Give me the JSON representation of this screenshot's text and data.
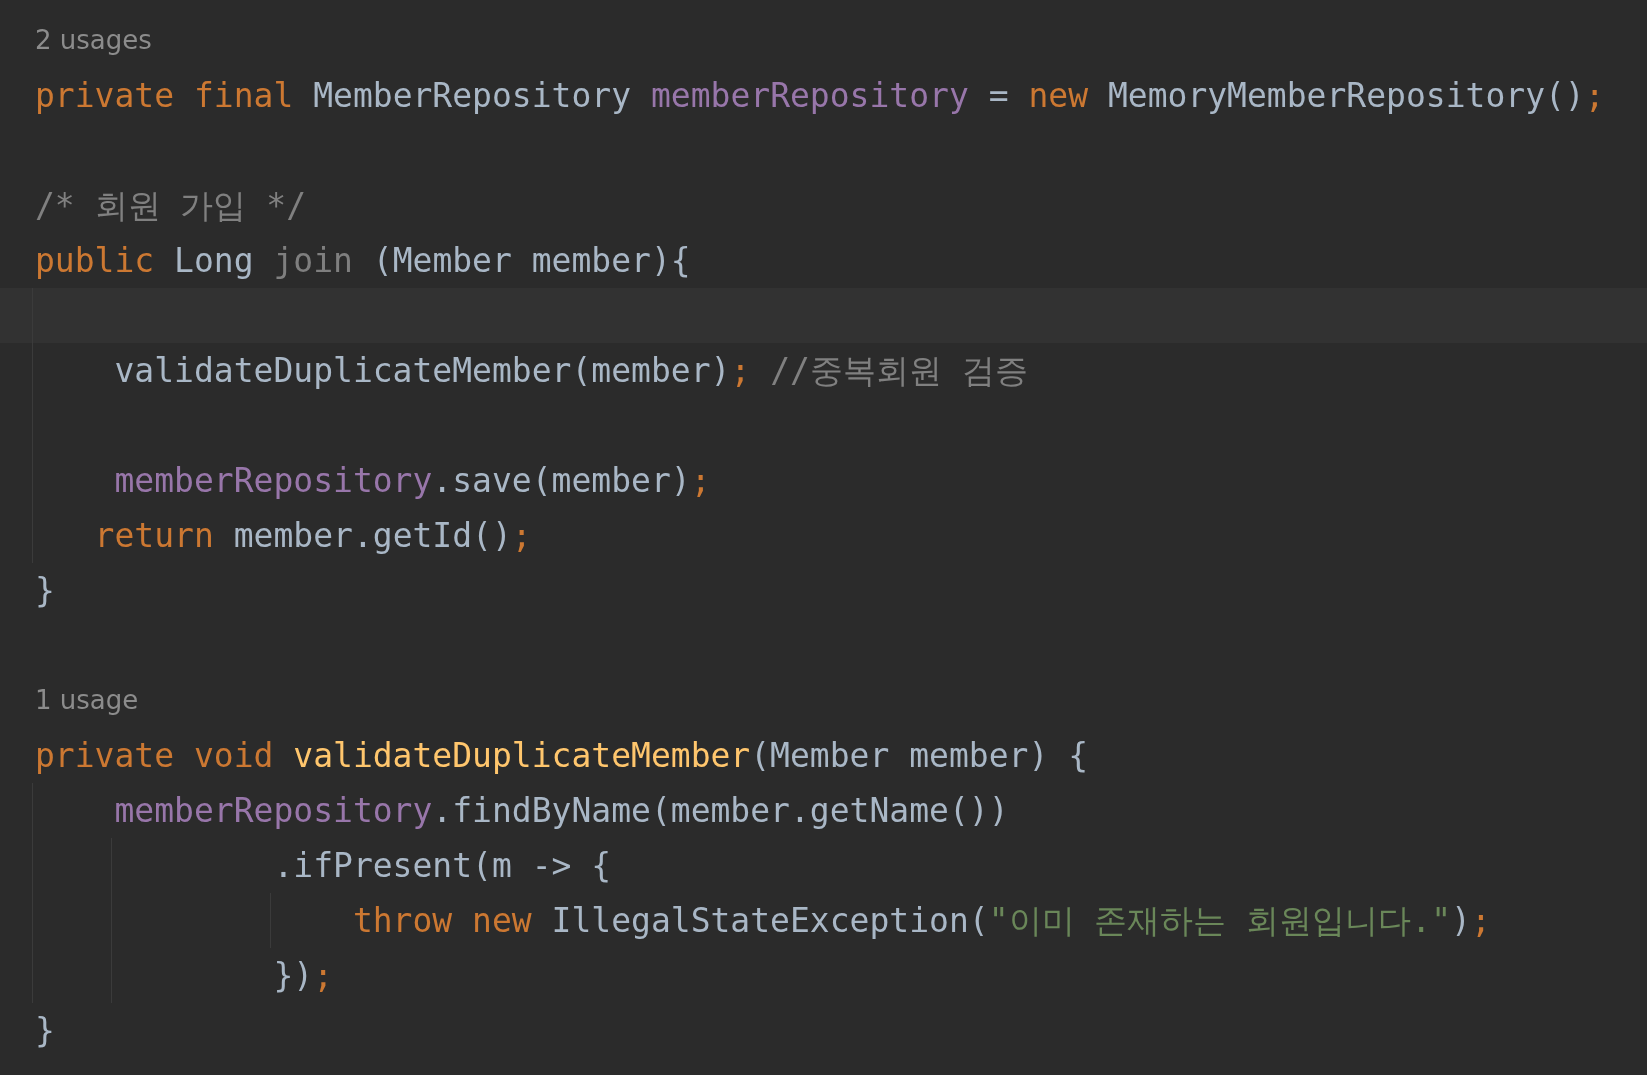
{
  "editor": {
    "lines": [
      {
        "kind": "hint",
        "text": "2 usages"
      },
      {
        "kind": "code",
        "tokens": [
          {
            "text": "private final ",
            "kind": "keyword"
          },
          {
            "text": "MemberRepository ",
            "kind": "plain"
          },
          {
            "text": "memberRepository",
            "kind": "field"
          },
          {
            "text": " = ",
            "kind": "plain"
          },
          {
            "text": "new ",
            "kind": "keyword"
          },
          {
            "text": "MemoryMemberRepository()",
            "kind": "plain"
          },
          {
            "text": ";",
            "kind": "keyword"
          }
        ]
      },
      {
        "kind": "blank"
      },
      {
        "kind": "code",
        "tokens": [
          {
            "text": "/* 회원 가입 */",
            "kind": "comment"
          }
        ]
      },
      {
        "kind": "code",
        "tokens": [
          {
            "text": "public ",
            "kind": "keyword"
          },
          {
            "text": "Long ",
            "kind": "plain"
          },
          {
            "text": "join",
            "kind": "unused"
          },
          {
            "text": " (Member member){",
            "kind": "plain"
          }
        ]
      },
      {
        "kind": "caret"
      },
      {
        "kind": "code",
        "tokens": [
          {
            "text": "    validateDuplicateMember(member)",
            "kind": "plain"
          },
          {
            "text": "; ",
            "kind": "keyword"
          },
          {
            "text": "//중복회원 검증",
            "kind": "comment"
          }
        ]
      },
      {
        "kind": "blank"
      },
      {
        "kind": "code",
        "tokens": [
          {
            "text": "    memberRepository",
            "kind": "field"
          },
          {
            "text": ".save(member)",
            "kind": "plain"
          },
          {
            "text": ";",
            "kind": "keyword"
          }
        ]
      },
      {
        "kind": "code",
        "tokens": [
          {
            "text": "   return ",
            "kind": "keyword"
          },
          {
            "text": "member.getId()",
            "kind": "plain"
          },
          {
            "text": ";",
            "kind": "keyword"
          }
        ]
      },
      {
        "kind": "code",
        "tokens": [
          {
            "text": "}",
            "kind": "plain"
          }
        ]
      },
      {
        "kind": "blank"
      },
      {
        "kind": "hint",
        "text": "1 usage"
      },
      {
        "kind": "code",
        "tokens": [
          {
            "text": "private void ",
            "kind": "keyword"
          },
          {
            "text": "validateDuplicateMember",
            "kind": "method"
          },
          {
            "text": "(Member member) {",
            "kind": "plain"
          }
        ]
      },
      {
        "kind": "code",
        "tokens": [
          {
            "text": "    memberRepository",
            "kind": "field"
          },
          {
            "text": ".findByName(member.getName())",
            "kind": "plain"
          }
        ]
      },
      {
        "kind": "code",
        "tokens": [
          {
            "text": "            .ifPresent(m -> {",
            "kind": "plain"
          }
        ]
      },
      {
        "kind": "code",
        "tokens": [
          {
            "text": "                throw new ",
            "kind": "keyword"
          },
          {
            "text": "IllegalStateException(",
            "kind": "plain"
          },
          {
            "text": "\"이미 존재하는 회원입니다.\"",
            "kind": "string"
          },
          {
            "text": ")",
            "kind": "plain"
          },
          {
            "text": ";",
            "kind": "keyword"
          }
        ]
      },
      {
        "kind": "code",
        "tokens": [
          {
            "text": "            })",
            "kind": "plain"
          },
          {
            "text": ";",
            "kind": "keyword"
          }
        ]
      },
      {
        "kind": "code",
        "tokens": [
          {
            "text": "}",
            "kind": "plain"
          }
        ]
      }
    ]
  }
}
